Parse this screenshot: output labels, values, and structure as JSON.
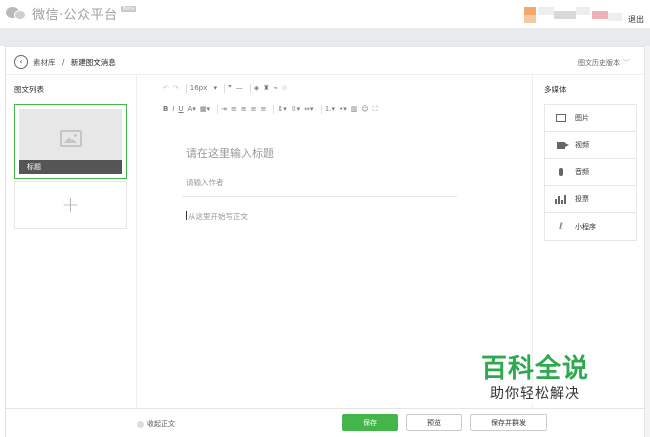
{
  "header": {
    "logo_text": "微信·公众平台",
    "beta_badge": "Beta",
    "logout": "退出",
    "mosaic_colors": [
      "#f4a96b",
      "#f7c9a0",
      "#d9d9d9",
      "#c8c8c8",
      "#f2b0b8",
      "#eeeeee"
    ]
  },
  "breadcrumb": {
    "root": "素材库",
    "separator": "/",
    "current": "新建图文消息",
    "history": "图文历史版本"
  },
  "left_panel": {
    "title": "图文列表",
    "card_title": "标题",
    "add_symbol": "+"
  },
  "toolbar": {
    "font_size": "16px"
  },
  "editor": {
    "title_placeholder": "请在这里输入标题",
    "author_placeholder": "请输入作者",
    "body_placeholder": "从这里开始写正文"
  },
  "right_panel": {
    "title": "多媒体",
    "items": [
      {
        "label": "图片",
        "icon": "image-icon"
      },
      {
        "label": "视频",
        "icon": "video-icon"
      },
      {
        "label": "音频",
        "icon": "audio-icon"
      },
      {
        "label": "投票",
        "icon": "vote-icon"
      },
      {
        "label": "小程序",
        "icon": "mini-program-icon"
      }
    ]
  },
  "footer": {
    "collapse": "收起正文",
    "save": "保存",
    "preview": "预览",
    "save_and_send": "保存并群发"
  },
  "watermark": {
    "line1": "百科全说",
    "line2": "助你轻松解决"
  },
  "colors": {
    "accent": "#44b549",
    "watermark": "#2fa84f"
  }
}
